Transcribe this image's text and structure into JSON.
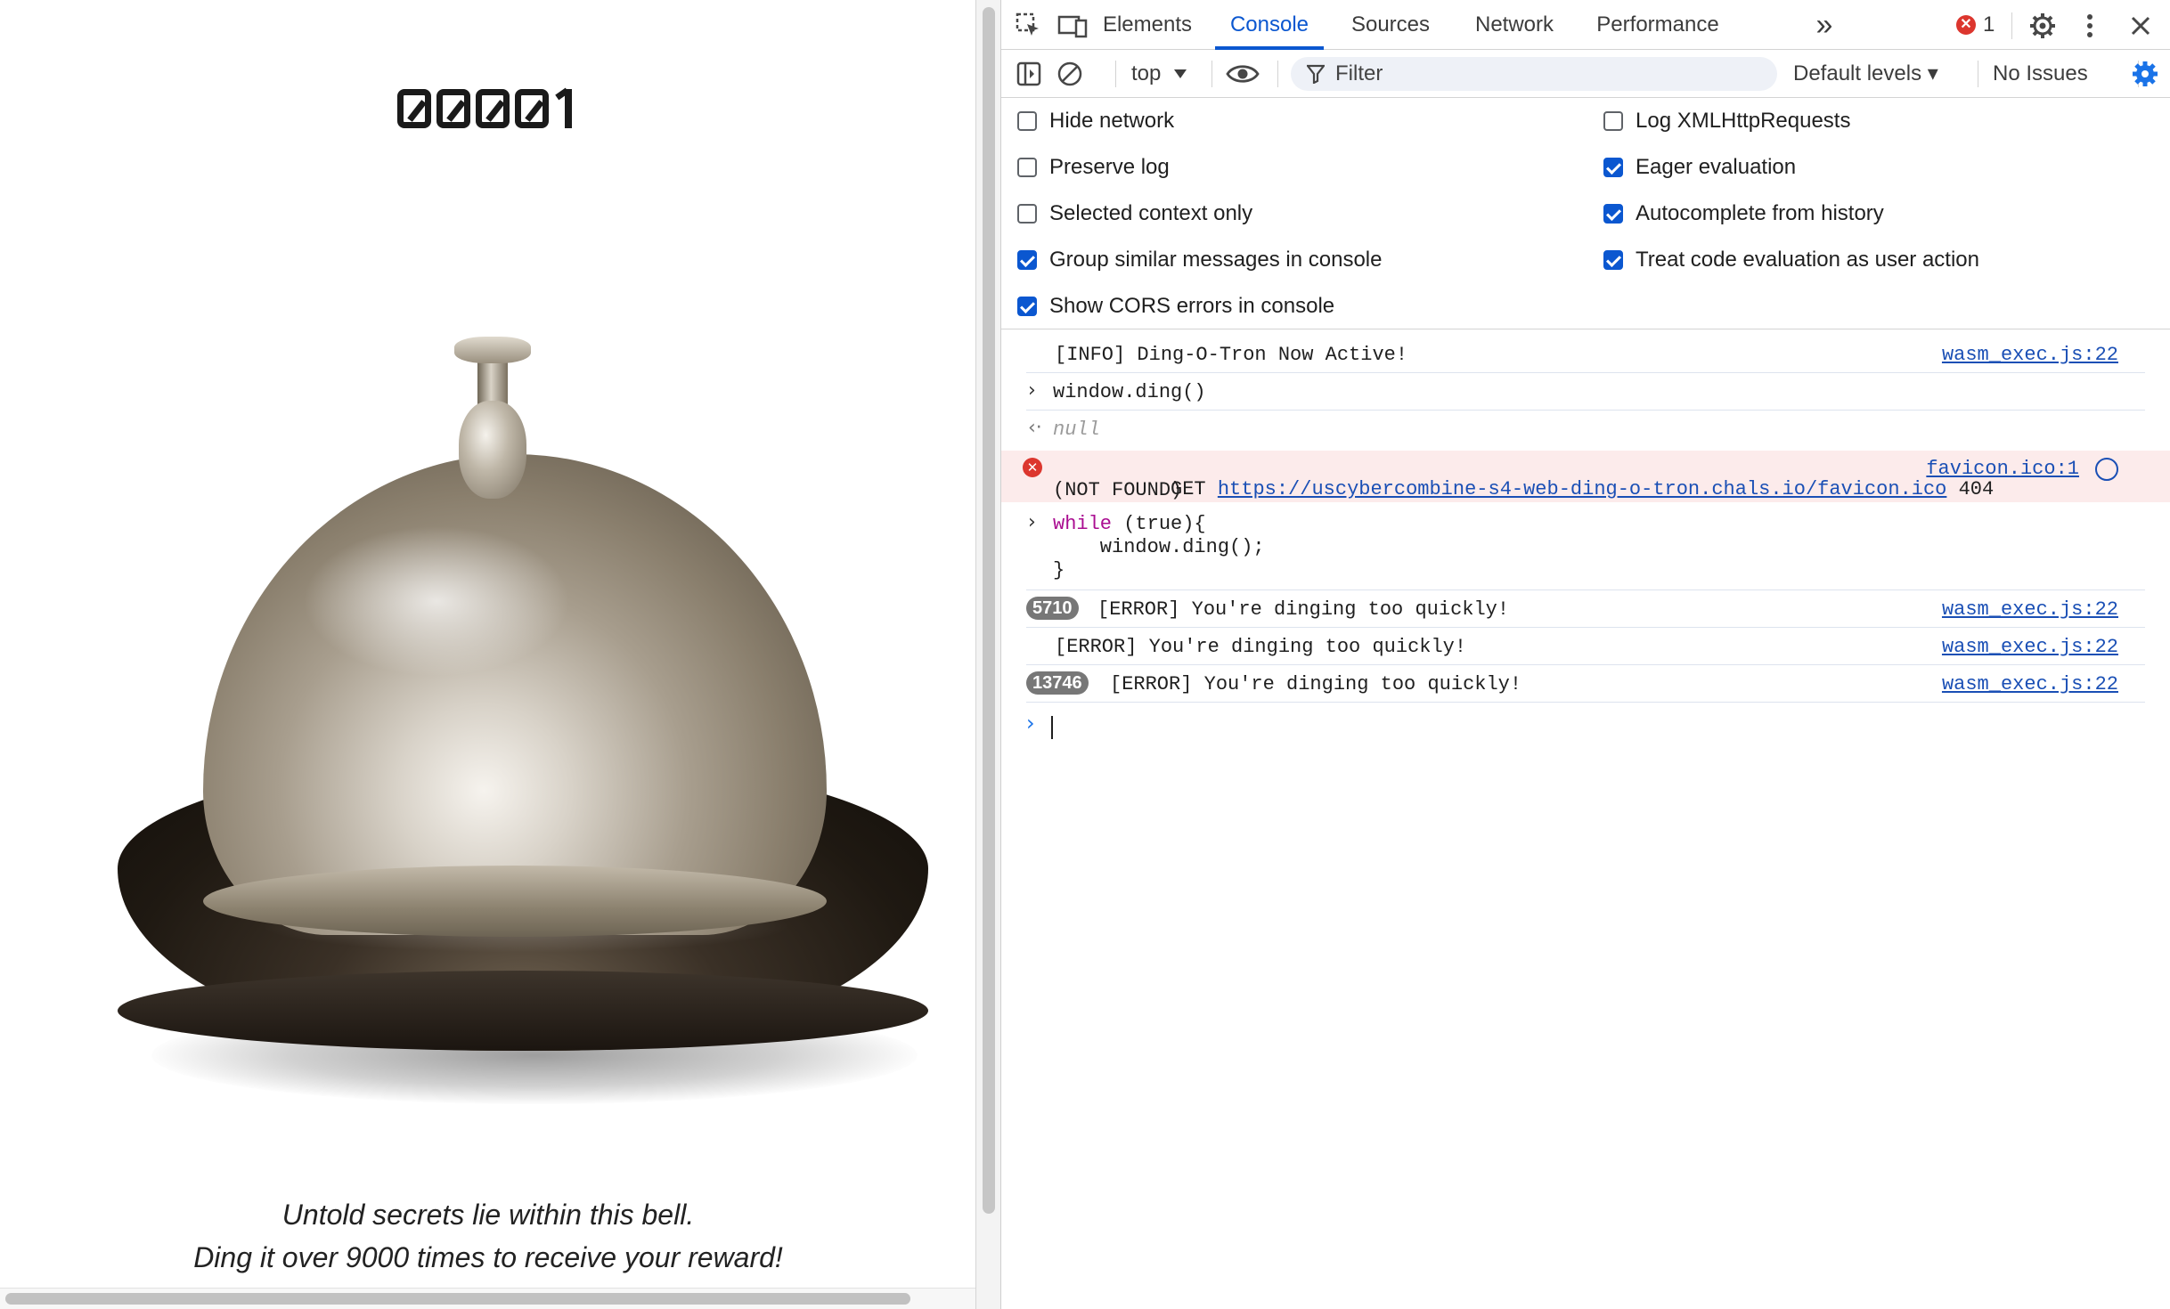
{
  "page": {
    "counter": "00001",
    "caption_line1": "Untold secrets lie within this bell.",
    "caption_line2": "Ding it over 9000 times to receive your reward!"
  },
  "devtools": {
    "tabs": [
      "Elements",
      "Console",
      "Sources",
      "Network",
      "Performance"
    ],
    "active_tab": "Console",
    "error_count": "1",
    "error_icon_glyph": "✕",
    "more_tabs_glyph": "»",
    "context": "top",
    "filter_placeholder": "Filter",
    "levels": "Default levels ▾",
    "issues": "No Issues",
    "settings_left": [
      {
        "label": "Hide network",
        "checked": false
      },
      {
        "label": "Preserve log",
        "checked": false
      },
      {
        "label": "Selected context only",
        "checked": false
      },
      {
        "label": "Group similar messages in console",
        "checked": true
      },
      {
        "label": "Show CORS errors in console",
        "checked": true
      }
    ],
    "settings_right": [
      {
        "label": "Log XMLHttpRequests",
        "checked": false
      },
      {
        "label": "Eager evaluation",
        "checked": true
      },
      {
        "label": "Autocomplete from history",
        "checked": true
      },
      {
        "label": "Treat code evaluation as user action",
        "checked": true
      }
    ],
    "console": {
      "info_msg": "[INFO] Ding-O-Tron Now Active!",
      "info_src": "wasm_exec.js:22",
      "input1": "window.ding()",
      "result1": "null",
      "get_prefix": "GET ",
      "get_url": "https://uscybercombine-s4-web-ding-o-tron.chals.io/favicon.ico",
      "get_status": " 404",
      "get_status2": "(NOT FOUND)",
      "get_src": "favicon.ico:1",
      "input2_kw": "while",
      "input2_l1_rest": " (true){",
      "input2_l2": "    window.ding();",
      "input2_l3": "}",
      "err1_count": "5710",
      "err_msg": "[ERROR] You're dinging too quickly!",
      "err_src": "wasm_exec.js:22",
      "err3_count": "13746"
    }
  }
}
